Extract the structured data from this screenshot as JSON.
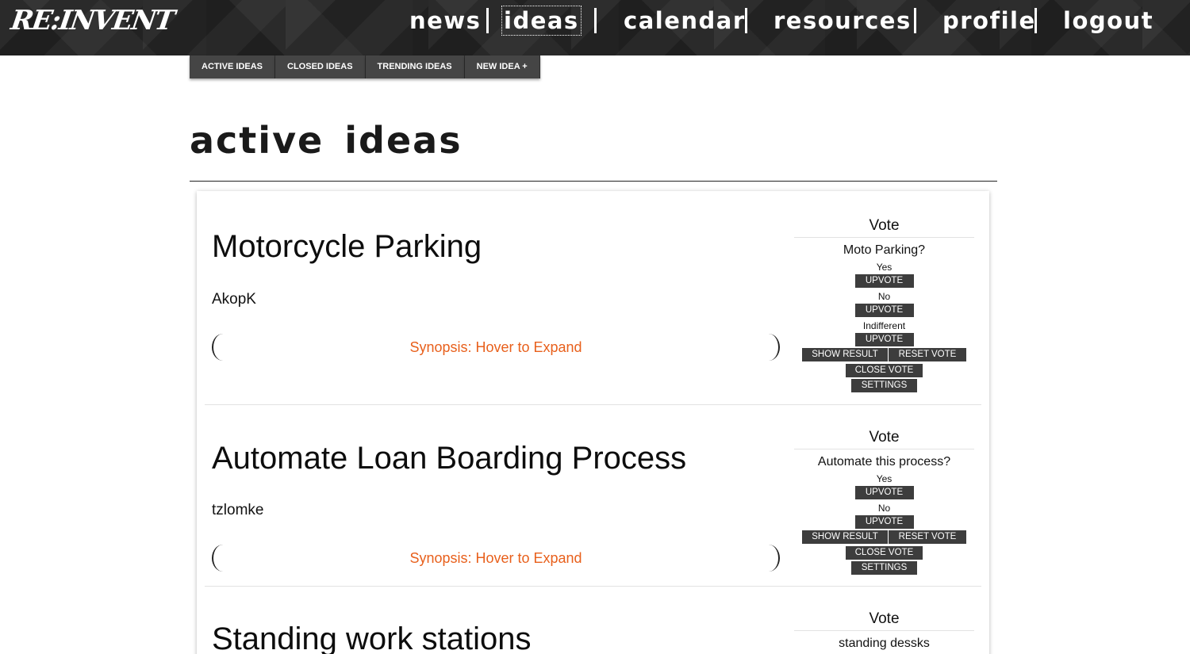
{
  "logo": {
    "text": "RE:INVENT"
  },
  "nav": {
    "items": [
      {
        "label": "news"
      },
      {
        "label": "ideas",
        "active": true
      },
      {
        "label": "calendar"
      },
      {
        "label": "resources"
      },
      {
        "label": "profile"
      },
      {
        "label": "logout"
      }
    ]
  },
  "subtabs": [
    {
      "label": "ACTIVE IDEAS"
    },
    {
      "label": "CLOSED IDEAS"
    },
    {
      "label": "TRENDING IDEAS"
    },
    {
      "label": "NEW IDEA +"
    }
  ],
  "page_title": "active ideas",
  "ideas": [
    {
      "title": "Motorcycle Parking",
      "author": "AkopK",
      "synopsis_label": "Synopsis: Hover to Expand",
      "vote": {
        "heading": "Vote",
        "question": "Moto Parking?",
        "options": [
          {
            "label": "Yes",
            "button": "UPVOTE"
          },
          {
            "label": "No",
            "button": "UPVOTE"
          },
          {
            "label": "Indifferent",
            "button": "UPVOTE"
          }
        ],
        "show_result": "SHOW RESULT",
        "reset_vote": "RESET VOTE",
        "close_vote": "CLOSE VOTE",
        "settings": "SETTINGS"
      }
    },
    {
      "title": "Automate Loan Boarding Process",
      "author": "tzlomke",
      "synopsis_label": "Synopsis: Hover to Expand",
      "vote": {
        "heading": "Vote",
        "question": "Automate this process?",
        "options": [
          {
            "label": "Yes",
            "button": "UPVOTE"
          },
          {
            "label": "No",
            "button": "UPVOTE"
          }
        ],
        "show_result": "SHOW RESULT",
        "reset_vote": "RESET VOTE",
        "close_vote": "CLOSE VOTE",
        "settings": "SETTINGS"
      }
    },
    {
      "title": "Standing work stations",
      "vote": {
        "heading": "Vote",
        "question": "standing dessks"
      }
    }
  ],
  "colors": {
    "topbar_bg": "#2a2a2a",
    "tab_bg": "#454545",
    "button_bg": "#3d3d3d",
    "synopsis_accent": "#e8601c"
  }
}
